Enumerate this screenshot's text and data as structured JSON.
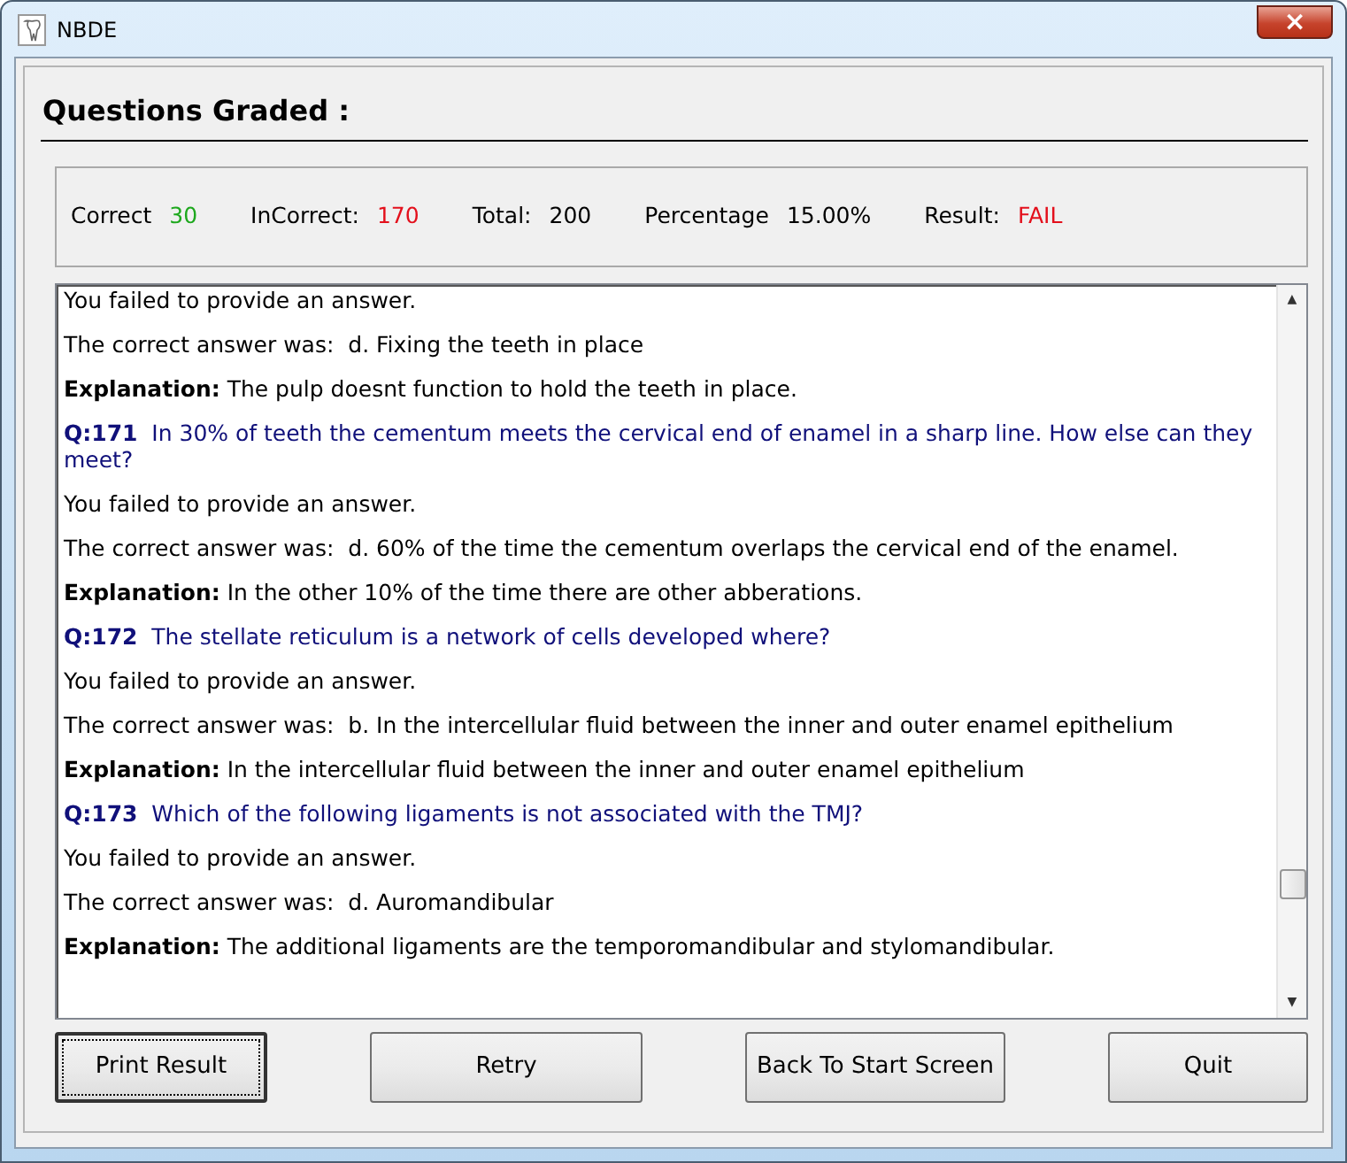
{
  "window": {
    "title": "NBDE",
    "close": "×"
  },
  "heading": "Questions Graded :",
  "stats": [
    {
      "label": "Correct",
      "value": "30",
      "color": "#1ea81e"
    },
    {
      "label": "InCorrect:",
      "value": "170",
      "color": "#e3101c"
    },
    {
      "label": "Total:",
      "value": "200",
      "color": "#000000"
    },
    {
      "label": "Percentage",
      "value": "15.00%",
      "color": "#000000"
    },
    {
      "label": "Result:",
      "value": "FAIL",
      "color": "#e3101c"
    }
  ],
  "results": [
    {
      "kind": "plain",
      "text": "You failed to provide an answer."
    },
    {
      "kind": "plain",
      "text": "The correct answer was:  d. Fixing the teeth in place"
    },
    {
      "kind": "plain",
      "text": "**Explanation:** The pulp doesnt function to hold the teeth in place."
    },
    {
      "kind": "question",
      "text": "**Q:171**  In 30% of teeth the cementum meets the cervical end of enamel in a sharp line. How else can they meet?"
    },
    {
      "kind": "plain",
      "text": "You failed to provide an answer."
    },
    {
      "kind": "plain",
      "text": "The correct answer was:  d. 60% of the time the cementum overlaps the cervical end of the enamel."
    },
    {
      "kind": "plain",
      "text": "**Explanation:** In the other 10% of the time there are other abberations."
    },
    {
      "kind": "question",
      "text": "**Q:172**  The stellate reticulum is a network of cells developed where?"
    },
    {
      "kind": "plain",
      "text": "You failed to provide an answer."
    },
    {
      "kind": "plain",
      "text": "The correct answer was:  b. In the intercellular fluid between the inner and outer enamel epithelium"
    },
    {
      "kind": "plain",
      "text": "**Explanation:** In the intercellular fluid between the inner and outer enamel epithelium"
    },
    {
      "kind": "question",
      "text": "**Q:173**  Which of the following ligaments is not associated with the TMJ?"
    },
    {
      "kind": "plain",
      "text": "You failed to provide an answer."
    },
    {
      "kind": "plain",
      "text": "The correct answer was:  d. Auromandibular"
    },
    {
      "kind": "plain",
      "text": "**Explanation:** The additional ligaments are the temporomandibular and stylomandibular."
    }
  ],
  "scrollbar": {
    "up": "▲",
    "down": "▼"
  },
  "buttons": [
    {
      "label": "Print Result",
      "focused": true
    },
    {
      "label": "Retry",
      "focused": false
    },
    {
      "label": "Back To Start Screen",
      "focused": false
    },
    {
      "label": "Quit",
      "focused": false
    }
  ]
}
